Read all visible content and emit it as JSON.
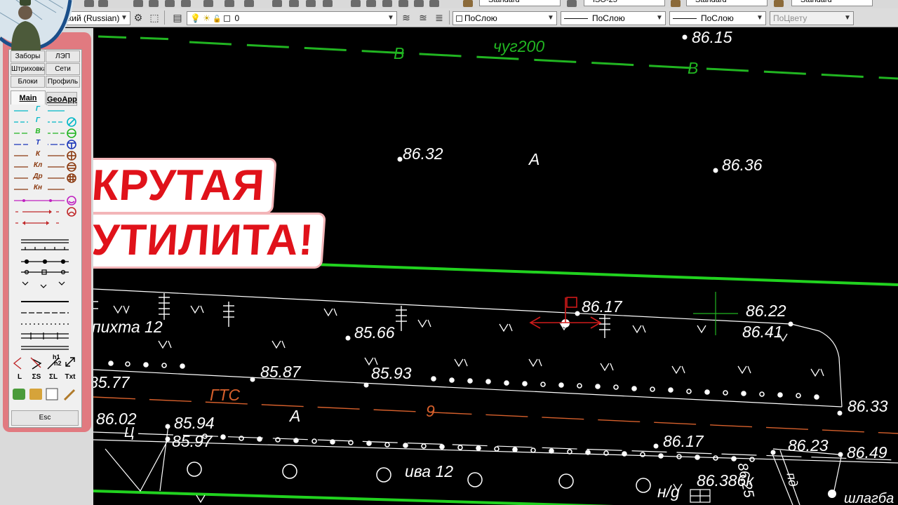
{
  "toolbar": {
    "language_combo": "кий (Russian)",
    "layer_combo": "0",
    "color_combo": "ПоСлою",
    "linetype_combo": "ПоСлою",
    "lineweight_combo": "ПоСлою",
    "plotstyle_combo": "ПоЦвету",
    "row1_combos": [
      "Standard",
      "ISO-25",
      "Standard",
      "Standard"
    ]
  },
  "panel": {
    "buttons": [
      {
        "label": "Заборы"
      },
      {
        "label": "ЛЭП"
      },
      {
        "label": "Штриховка"
      },
      {
        "label": "Сети"
      },
      {
        "label": "Блоки"
      },
      {
        "label": "Профиль"
      }
    ],
    "tabs": {
      "main": "Main",
      "geoapp": "GeoApp"
    },
    "line_tools": [
      {
        "label": "Г",
        "color": "#00b7c7",
        "icon": "none-icon"
      },
      {
        "label": "Г",
        "color": "#00b7c7",
        "icon": "slash-circle-icon"
      },
      {
        "label": "В",
        "color": "#21b521",
        "icon": "horizontal-circle-icon"
      },
      {
        "label": "Т",
        "color": "#1a35b8",
        "icon": "steering-circle-icon"
      },
      {
        "label": "К",
        "color": "#8b3a10",
        "icon": "cross-circle-icon"
      },
      {
        "label": "Кл",
        "color": "#8b3a10",
        "icon": "lines-circle-icon"
      },
      {
        "label": "Др",
        "color": "#8b3a10",
        "icon": "grid-circle-icon"
      },
      {
        "label": "Кн",
        "color": "#8b3a10",
        "icon": "none-icon"
      }
    ],
    "bottom_labels": [
      "L",
      "ΣS",
      "ΣL",
      "Txt"
    ],
    "profile_label_h1": "h1",
    "profile_label_h2": "h2",
    "esc_label": "Esc"
  },
  "drawing": {
    "labels": {
      "e8615": "86.15",
      "v_left": "В",
      "chug": "чуг200",
      "v_right": "В",
      "e8632": "86.32",
      "a_top": "А",
      "e8636": "86.36",
      "e8617": "86.17",
      "e8622": "86.22",
      "e8641": "86.41",
      "pikhta": "пихта 12",
      "e8566": "85.66",
      "e8587": "85.87",
      "e8593": "85.93",
      "e8577": "85.77",
      "gts": "ГТС",
      "nine": "9",
      "e8633": "86.33",
      "e8602": "86.02",
      "a_bottom": "А",
      "e8594": "85.94",
      "ts": "Ц",
      "e8597": "85.97",
      "e8617b": "86.17",
      "e8623": "86.23",
      "e8649": "86.49",
      "iva": "ива 12",
      "ng": "н/g",
      "e86386": "86.386к",
      "e8625": "86.25",
      "shlagba": "шлагба",
      "pd": "пд"
    }
  },
  "overlay": {
    "line1": "КРУТАЯ",
    "line2": "УТИЛИТА!"
  },
  "colors": {
    "canvas": "#000000",
    "green_line": "#21d21f",
    "red_overlay": "#e0121a",
    "panel_border": "#e17a80"
  }
}
